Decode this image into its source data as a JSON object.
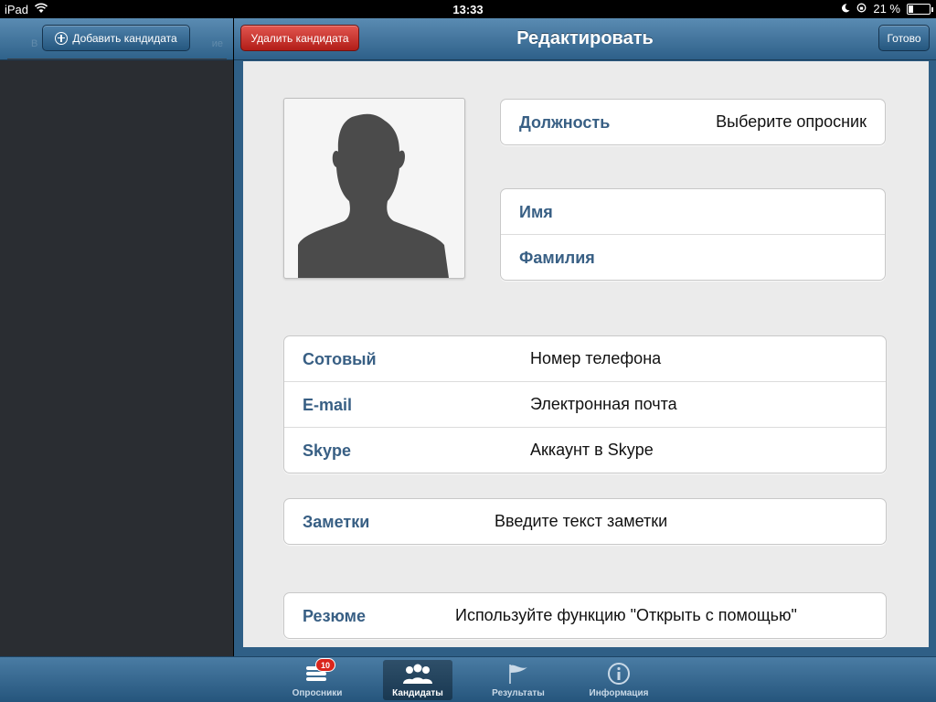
{
  "status_bar": {
    "device": "iPad",
    "time": "13:33",
    "battery": "21 %",
    "battery_level": 0.21
  },
  "left_pane": {
    "add_button_label": "Добавить кандидата",
    "hidden_labels": [
      "В",
      "ие"
    ]
  },
  "nav": {
    "title": "Редактировать",
    "delete_label": "Удалить кандидата",
    "done_label": "Готово"
  },
  "form": {
    "position": {
      "label": "Должность",
      "value": "Выберите опросник"
    },
    "first_name": {
      "label": "Имя",
      "value": ""
    },
    "last_name": {
      "label": "Фамилия",
      "value": ""
    },
    "phone": {
      "label": "Сотовый",
      "value": "Номер телефона"
    },
    "email": {
      "label": "E-mail",
      "value": "Электронная почта"
    },
    "skype": {
      "label": "Skype",
      "value": "Аккаунт в Skype"
    },
    "notes": {
      "label": "Заметки",
      "value": "Введите текст заметки"
    },
    "resume": {
      "label": "Резюме",
      "value": "Используйте функцию \"Открыть с помощью\""
    }
  },
  "tabs": [
    {
      "label": "Опросники",
      "icon": "list-icon",
      "badge": "10",
      "active": false
    },
    {
      "label": "Кандидаты",
      "icon": "people-icon",
      "active": true
    },
    {
      "label": "Результаты",
      "icon": "flag-icon",
      "active": false
    },
    {
      "label": "Информация",
      "icon": "info-icon",
      "active": false
    }
  ],
  "colors": {
    "accent": "#385f84",
    "toolbar": "#2e6089",
    "delete": "#c62a23",
    "badge": "#d9251c"
  }
}
